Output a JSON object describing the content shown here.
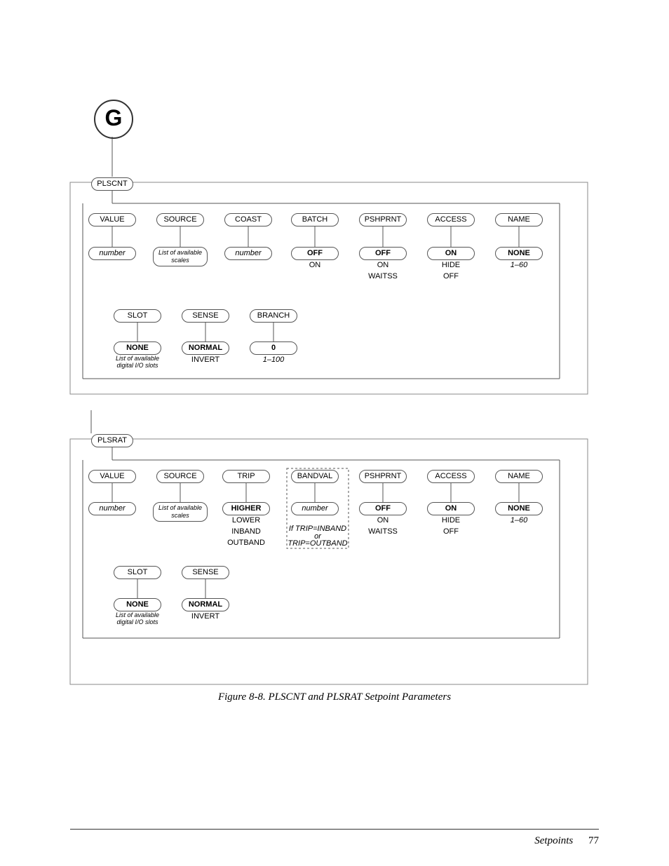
{
  "start_label": "G",
  "figure_caption": "Figure 8-8. PLSCNT and PLSRAT Setpoint Parameters",
  "footer_section": "Setpoints",
  "footer_page": "77",
  "plscnt": {
    "name": "PLSCNT",
    "row1": [
      "VALUE",
      "SOURCE",
      "COAST",
      "BATCH",
      "PSHPRNT",
      "ACCESS",
      "NAME"
    ],
    "value_opt": "number",
    "source_opt": "List of available scales",
    "coast_opt": "number",
    "batch_opts": [
      "OFF",
      "ON"
    ],
    "pshprnt_opts": [
      "OFF",
      "ON",
      "WAITSS"
    ],
    "access_opts": [
      "ON",
      "HIDE",
      "OFF"
    ],
    "name_opts": [
      "NONE",
      "1–60"
    ],
    "row2": [
      "SLOT",
      "SENSE",
      "BRANCH"
    ],
    "slot_opts": [
      "NONE",
      "List of available digital I/O slots"
    ],
    "sense_opts": [
      "NORMAL",
      "INVERT"
    ],
    "branch_opts": [
      "0",
      "1–100"
    ]
  },
  "plsrat": {
    "name": "PLSRAT",
    "row1": [
      "VALUE",
      "SOURCE",
      "TRIP",
      "BANDVAL",
      "PSHPRNT",
      "ACCESS",
      "NAME"
    ],
    "value_opt": "number",
    "source_opt": "List of available scales",
    "trip_opts": [
      "HIGHER",
      "LOWER",
      "INBAND",
      "OUTBAND"
    ],
    "bandval_opt": "number",
    "bandval_note1": "If TRIP=INBAND",
    "bandval_note2": "or",
    "bandval_note3": "TRIP=OUTBAND",
    "pshprnt_opts": [
      "OFF",
      "ON",
      "WAITSS"
    ],
    "access_opts": [
      "ON",
      "HIDE",
      "OFF"
    ],
    "name_opts": [
      "NONE",
      "1–60"
    ],
    "row2": [
      "SLOT",
      "SENSE"
    ],
    "slot_opts": [
      "NONE",
      "List of available digital I/O slots"
    ],
    "sense_opts": [
      "NORMAL",
      "INVERT"
    ]
  }
}
